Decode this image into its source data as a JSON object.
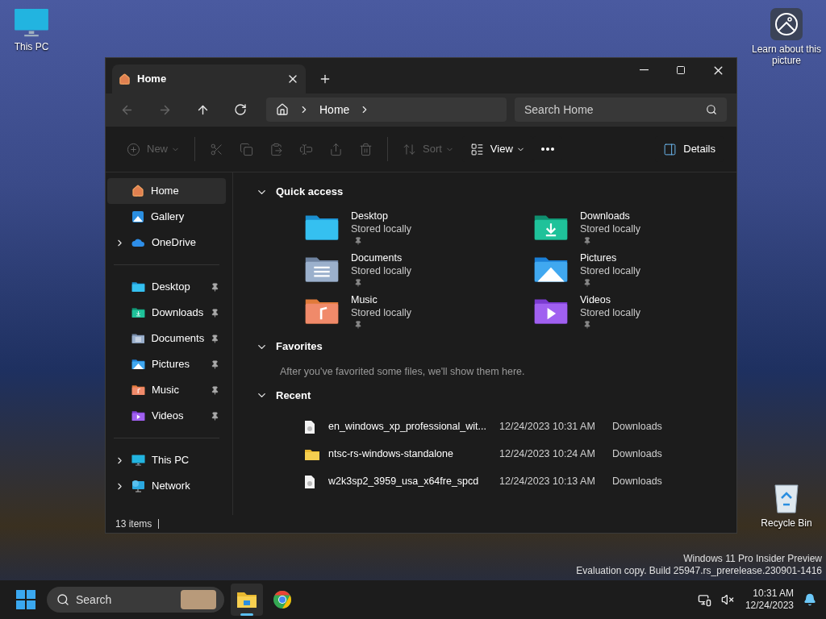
{
  "desktop_icons": [
    {
      "kind": "pc",
      "label": "This PC"
    },
    {
      "kind": "picture",
      "label": "Learn about this picture"
    },
    {
      "kind": "bin",
      "label": "Recycle Bin"
    }
  ],
  "watermark": [
    "Windows 11 Pro Insider Preview",
    "Evaluation copy. Build 25947.rs_prerelease.230901-1416"
  ],
  "window": {
    "tabs": [
      {
        "label": "Home",
        "selected": true
      }
    ],
    "address": [
      "Home"
    ],
    "search": {
      "placeholder": "Search Home"
    },
    "toolbar": [
      {
        "kind": "new",
        "label": "New",
        "disabled": true
      },
      {
        "kind": "cut",
        "disabled": true
      },
      {
        "kind": "copy",
        "disabled": true
      },
      {
        "kind": "paste",
        "disabled": true
      },
      {
        "kind": "rename",
        "disabled": true
      },
      {
        "kind": "share",
        "disabled": true
      },
      {
        "kind": "delete",
        "disabled": true
      },
      {
        "kind": "sort",
        "label": "Sort",
        "disabled": true
      },
      {
        "kind": "view",
        "label": "View",
        "disabled": false
      },
      {
        "kind": "more",
        "disabled": false
      },
      {
        "kind": "details",
        "label": "Details",
        "disabled": false
      }
    ],
    "sidebar": [
      [
        {
          "kind": "home",
          "label": "Home",
          "selected": true
        },
        {
          "kind": "gallery",
          "label": "Gallery",
          "selected": false
        },
        {
          "kind": "cloud",
          "label": "OneDrive",
          "selected": false,
          "expanded": false
        }
      ],
      [
        {
          "kind": "desktop",
          "label": "Desktop",
          "selected": false,
          "pinned": true
        },
        {
          "kind": "downloads",
          "label": "Downloads",
          "selected": false,
          "pinned": true
        },
        {
          "kind": "documents",
          "label": "Documents",
          "selected": false,
          "pinned": true
        },
        {
          "kind": "pictures",
          "label": "Pictures",
          "selected": false,
          "pinned": true
        },
        {
          "kind": "music",
          "label": "Music",
          "selected": false,
          "pinned": true
        },
        {
          "kind": "videos",
          "label": "Videos",
          "selected": false,
          "pinned": true
        }
      ],
      [
        {
          "kind": "pc",
          "label": "This PC",
          "selected": false,
          "expanded": false
        },
        {
          "kind": "network",
          "label": "Network",
          "selected": false,
          "expanded": false
        }
      ]
    ],
    "sections": [
      {
        "kind": "folders",
        "title": "Quick access",
        "expanded": true,
        "items": [
          {
            "kind": "desktop",
            "name": "Desktop",
            "status": "Stored locally",
            "pinned": true
          },
          {
            "kind": "downloads",
            "name": "Downloads",
            "status": "Stored locally",
            "pinned": true
          },
          {
            "kind": "documents",
            "name": "Documents",
            "status": "Stored locally",
            "pinned": true
          },
          {
            "kind": "pictures",
            "name": "Pictures",
            "status": "Stored locally",
            "pinned": true
          },
          {
            "kind": "music",
            "name": "Music",
            "status": "Stored locally",
            "pinned": true
          },
          {
            "kind": "videos",
            "name": "Videos",
            "status": "Stored locally",
            "pinned": true
          }
        ]
      },
      {
        "kind": "message",
        "title": "Favorites",
        "expanded": true,
        "message": "After you've favorited some files, we'll show them here."
      },
      {
        "kind": "files",
        "title": "Recent",
        "expanded": true,
        "items": [
          {
            "kind": "file",
            "name": "en_windows_xp_professional_wit...",
            "date": "12/24/2023 10:31 AM",
            "location": "Downloads"
          },
          {
            "kind": "folder",
            "name": "ntsc-rs-windows-standalone",
            "date": "12/24/2023 10:24 AM",
            "location": "Downloads"
          },
          {
            "kind": "file",
            "name": "w2k3sp2_3959_usa_x64fre_spcd",
            "date": "12/24/2023 10:13 AM",
            "location": "Downloads"
          }
        ]
      }
    ],
    "status_bar": "13 items"
  },
  "taskbar": {
    "search": {
      "placeholder": "Search"
    },
    "apps": [
      {
        "kind": "explorer",
        "selected": true
      },
      {
        "kind": "chrome",
        "selected": false
      }
    ],
    "time": "10:31 AM",
    "date": "12/24/2023"
  }
}
